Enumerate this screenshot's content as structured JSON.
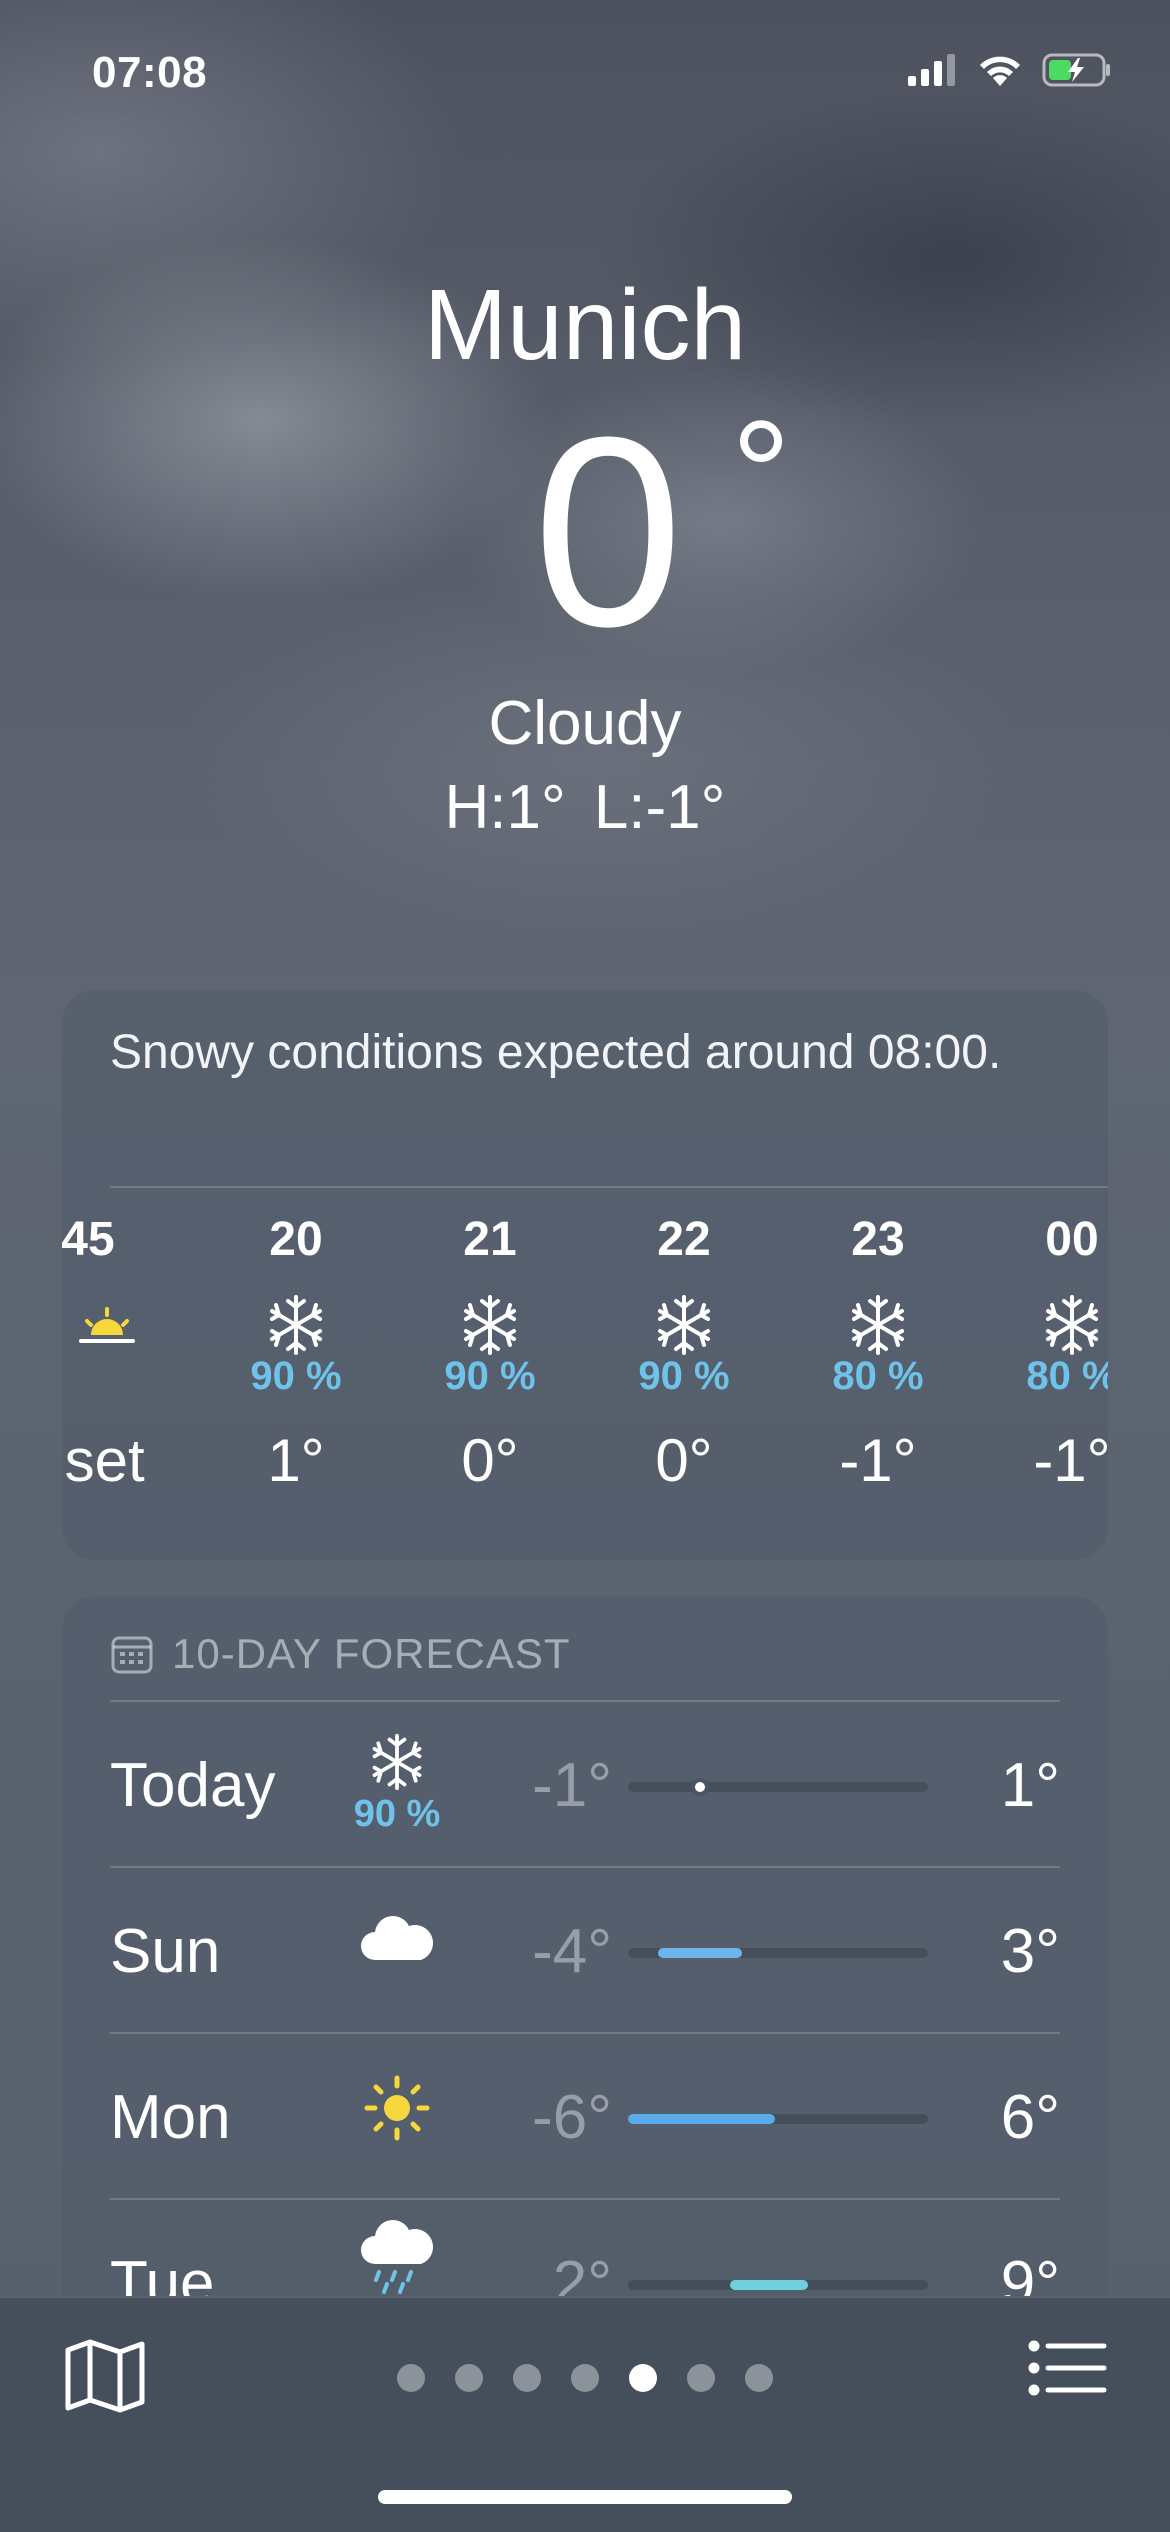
{
  "status_bar": {
    "time": "07:08"
  },
  "header": {
    "city": "Munich",
    "temperature": "0",
    "degree_symbol": "°",
    "condition": "Cloudy",
    "high": "H:1°",
    "low": "L:-1°"
  },
  "hourly": {
    "summary": "Snowy conditions expected around 08:00.",
    "hours": [
      {
        "time": "45",
        "icon": "sunset-icon",
        "precip": "",
        "temp": "nset"
      },
      {
        "time": "20",
        "icon": "snowflake-icon",
        "precip": "90 %",
        "temp": "1°"
      },
      {
        "time": "21",
        "icon": "snowflake-icon",
        "precip": "90 %",
        "temp": "0°"
      },
      {
        "time": "22",
        "icon": "snowflake-icon",
        "precip": "90 %",
        "temp": "0°"
      },
      {
        "time": "23",
        "icon": "snowflake-icon",
        "precip": "80 %",
        "temp": "-1°"
      },
      {
        "time": "00",
        "icon": "snowflake-icon",
        "precip": "80 %",
        "temp": "-1°"
      }
    ]
  },
  "daily": {
    "header": "10-DAY FORECAST",
    "days": [
      {
        "day": "Today",
        "icon": "snowflake-icon",
        "precip": "90 %",
        "low": "-1°",
        "high": "1°",
        "bar_start": 0.24,
        "bar_end": 0.24,
        "current_dot": true,
        "bar_color": "#ffffff"
      },
      {
        "day": "Sun",
        "icon": "cloud-icon",
        "precip": "",
        "low": "-4°",
        "high": "3°",
        "bar_start": 0.1,
        "bar_end": 0.38,
        "current_dot": false,
        "bar_color": "#6cb4ea"
      },
      {
        "day": "Mon",
        "icon": "sun-icon",
        "precip": "",
        "low": "-6°",
        "high": "6°",
        "bar_start": 0.0,
        "bar_end": 0.49,
        "current_dot": false,
        "bar_color": "#5aabea"
      },
      {
        "day": "Tue",
        "icon": "rain-cloud-icon",
        "precip": "",
        "low": "2°",
        "high": "9°",
        "bar_start": 0.34,
        "bar_end": 0.6,
        "current_dot": false,
        "bar_color": "#6fd0e0"
      }
    ]
  },
  "bottom_bar": {
    "page_count": 7,
    "active_page": 4
  },
  "colors": {
    "precip": "#6fc2ea",
    "sun": "#f6d73c",
    "battery": "#4cd964"
  }
}
